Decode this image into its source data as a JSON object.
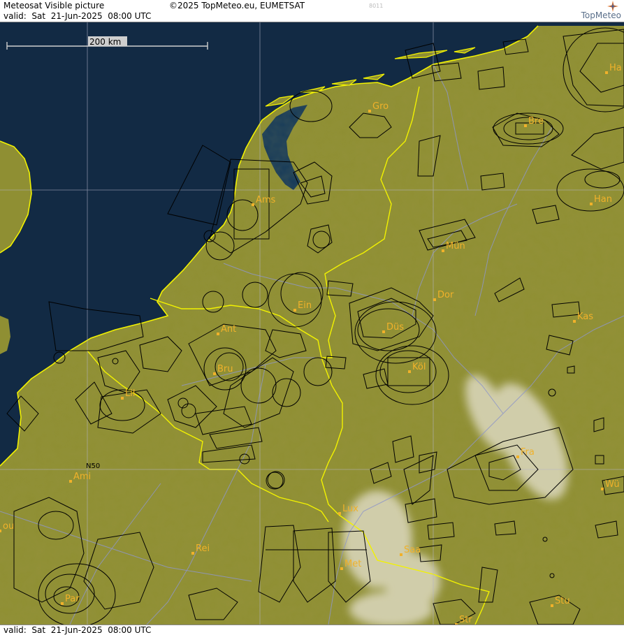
{
  "header": {
    "title": "Meteosat Visible picture",
    "valid": "valid:  Sat  21-Jun-2025  08:00 UTC",
    "copyright": "©2025 TopMeteo.eu, EUMETSAT",
    "image_code": "8011",
    "logo": "TopMeteo"
  },
  "map": {
    "scale_label": "200 km",
    "control_zone_label": "N50",
    "cities": [
      {
        "name": "Gro"
      },
      {
        "name": "Bre"
      },
      {
        "name": "Ha"
      },
      {
        "name": "Han"
      },
      {
        "name": "Ams"
      },
      {
        "name": "Mün"
      },
      {
        "name": "Dor"
      },
      {
        "name": "Ein"
      },
      {
        "name": "Kas"
      },
      {
        "name": "Ant"
      },
      {
        "name": "Düs"
      },
      {
        "name": "Bru"
      },
      {
        "name": "Köl"
      },
      {
        "name": "Lil"
      },
      {
        "name": "Fra"
      },
      {
        "name": "Ami"
      },
      {
        "name": "Wü"
      },
      {
        "name": "Lux"
      },
      {
        "name": "ou"
      },
      {
        "name": "Rei"
      },
      {
        "name": "Saa"
      },
      {
        "name": "Met"
      },
      {
        "name": "Par"
      },
      {
        "name": "Stu"
      },
      {
        "name": "Str"
      }
    ],
    "colors": {
      "sea": "#122a44",
      "land": "#8f8f33",
      "coast": "#f2f200",
      "rivers": "#8f97c8",
      "airspace": "#000000",
      "city": "#f0b12a",
      "cloud": "#e6e2d2"
    }
  },
  "footer": {
    "valid": "valid:  Sat  21-Jun-2025  08:00 UTC"
  }
}
